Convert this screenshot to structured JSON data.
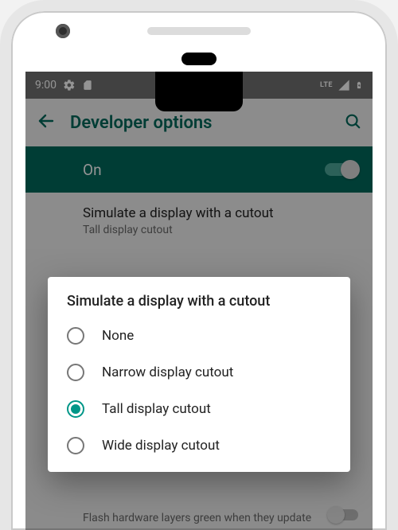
{
  "status": {
    "time": "9:00",
    "lte": "LTE"
  },
  "appbar": {
    "title": "Developer options"
  },
  "master": {
    "label": "On",
    "enabled": true
  },
  "current": {
    "title": "Simulate a display with a cutout",
    "subtitle": "Tall display cutout"
  },
  "bg_text": "Flash hardware layers green when they update",
  "dialog": {
    "title": "Simulate a display with a cutout",
    "selected": 2,
    "options": [
      "None",
      "Narrow display cutout",
      "Tall display cutout",
      "Wide display cutout"
    ]
  },
  "colors": {
    "accent": "#009688",
    "primary": "#00695c"
  }
}
